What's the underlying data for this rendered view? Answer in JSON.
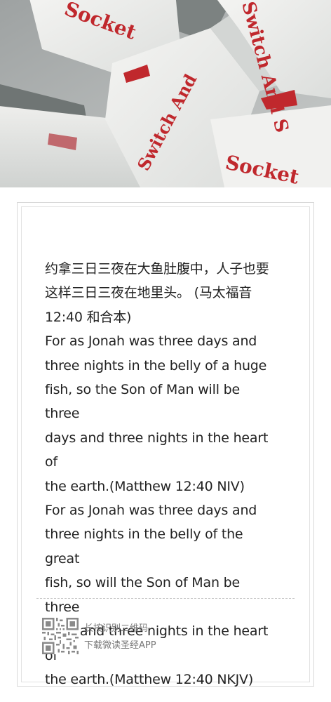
{
  "photo": {
    "labels": [
      "Socket",
      "Switch And",
      "Switch And S",
      "Socket"
    ]
  },
  "verse": {
    "lines": [
      "约拿三日三夜在大鱼肚腹中，人子也要",
      "这样三日三夜在地里头。 (马太福音",
      "12:40 和合本)",
      "For as Jonah was three days and",
      "three nights in the belly of a huge",
      "fish, so the Son of Man will be three",
      "days and three nights in the heart of",
      "the earth.(Matthew 12:40 NIV)",
      "For as Jonah was three days and",
      "three nights in the belly of the great",
      "fish, so will the Son of Man be three",
      "days and three nights in the heart of",
      "the earth.(Matthew 12:40 NKJV)"
    ]
  },
  "footer": {
    "line1": "长按识别二维码",
    "line2": "下载微读圣经APP"
  },
  "colors": {
    "text": "#222222",
    "muted": "#777777",
    "print_red": "#c0282d"
  }
}
